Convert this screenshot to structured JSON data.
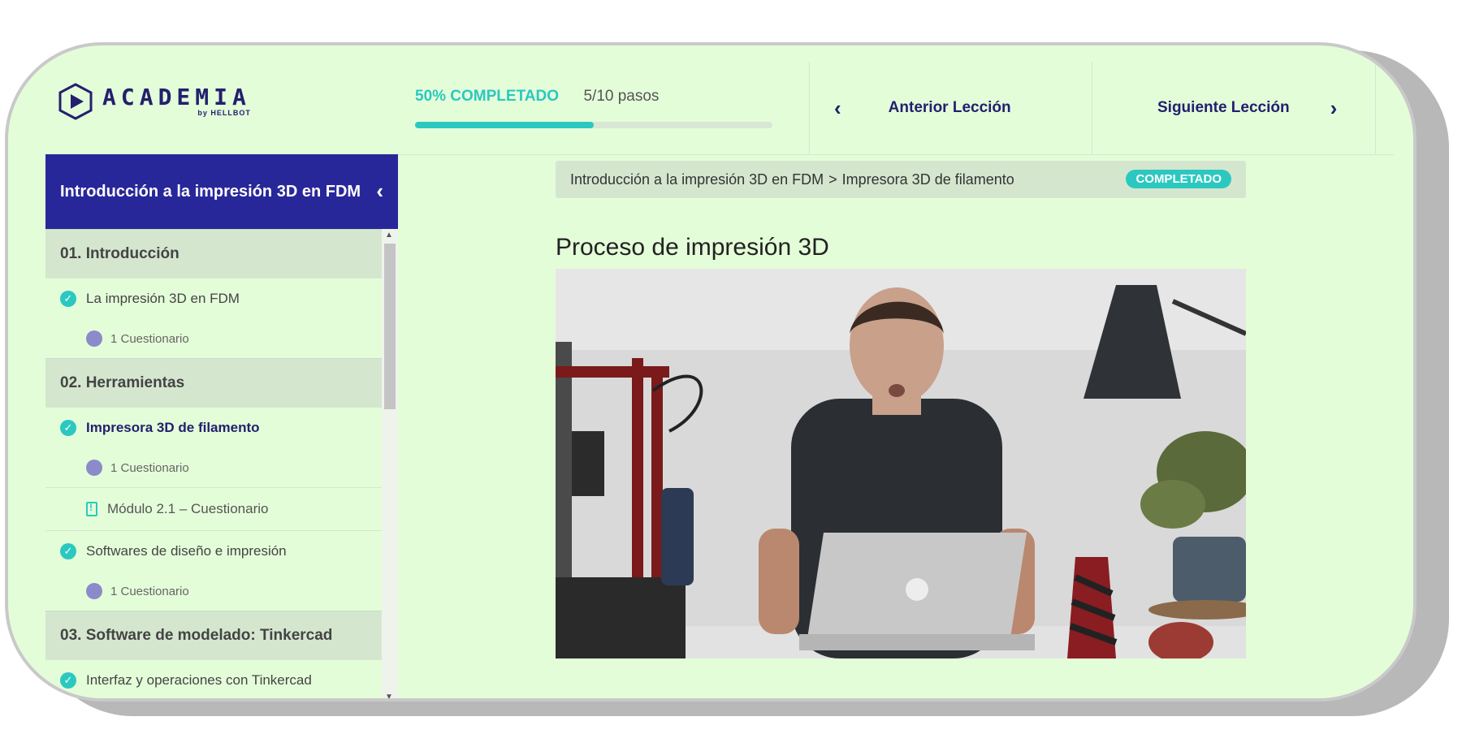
{
  "brand": {
    "name": "ACADEMIA",
    "by": "by HELLBOT",
    "color": "#23206e"
  },
  "progress": {
    "percent_label": "50% COMPLETADO",
    "steps_label": "5/10 pasos",
    "fraction": 0.5,
    "accent": "#2bc8c0"
  },
  "nav": {
    "prev_label": "Anterior Lección",
    "next_label": "Siguiente Lección",
    "prev_icon": "chevron-left-icon",
    "next_icon": "chevron-right-icon"
  },
  "course": {
    "title": "Introducción a la impresión 3D en FDM",
    "header_color": "#28279a"
  },
  "sidebar": {
    "sections": [
      {
        "title": "01. Introducción",
        "lessons": [
          {
            "title": "La impresión 3D en FDM",
            "quiz": "1 Cuestionario"
          }
        ]
      },
      {
        "title": "02. Herramientas",
        "lessons": [
          {
            "title": "Impresora 3D de filamento",
            "quiz": "1 Cuestionario",
            "active": true
          },
          {
            "title": "Módulo 2.1 – Cuestionario",
            "type": "quiz-module"
          },
          {
            "title": "Softwares de diseño e impresión",
            "quiz": "1 Cuestionario"
          }
        ]
      },
      {
        "title": "03. Software de modelado: Tinkercad",
        "lessons": [
          {
            "title": "Interfaz y operaciones con Tinkercad"
          }
        ]
      }
    ]
  },
  "breadcrumb": {
    "course": "Introducción a la impresión 3D en FDM",
    "separator": ">",
    "lesson": "Impresora 3D de filamento",
    "status": "COMPLETADO"
  },
  "lesson": {
    "title": "Proceso de impresión 3D"
  },
  "colors": {
    "background": "#e4fdd9",
    "panel": "#d5e6cf"
  }
}
